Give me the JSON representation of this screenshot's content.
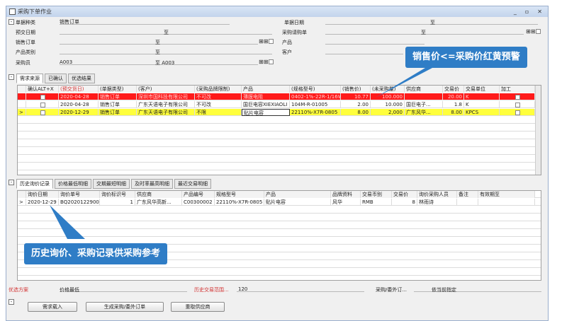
{
  "window": {
    "title": "采购下单作业",
    "minimize": "_",
    "maximize": "▫",
    "close": "✕"
  },
  "filters": {
    "doc_type_label": "单据种类",
    "doc_type_value": "销售订单",
    "doc_date_label": "单据日期",
    "doc_date_to": "至",
    "delivery_date_label": "预交日期",
    "delivery_date_to": "至",
    "purchase_req_label": "采购请购单",
    "purchase_req_to": "至",
    "sales_order_label": "销售订单",
    "sales_order_to": "至",
    "product_label": "产品",
    "product_to": "至",
    "product_cat_label": "产品类别",
    "product_cat_to": "至",
    "customer_label": "客户",
    "buyer_label": "采购员",
    "buyer_from": "A003",
    "buyer_to": "至 A003"
  },
  "upper_tabs": [
    "需求来源",
    "已确认",
    "优选结果"
  ],
  "upper_grid": {
    "columns": [
      "确认ALT+X",
      "(预交货日)",
      "(单据类型)",
      "(客户)",
      "(采购品牌限制)",
      "产品",
      "(规格型号)",
      "(销售价)",
      "(未采购量)",
      "供应商",
      "交易价",
      "交易单位",
      "加工"
    ],
    "rows": [
      {
        "date": "2020-04-28",
        "type": "销售订单",
        "customer": "深圳市国科技有限公司",
        "brand": "不可改",
        "product": "薄膜电阻",
        "spec": "0402-1%-22R-1/16W",
        "price": "10.77",
        "qty": "100.000",
        "supplier": "",
        "trade_price": "20.00",
        "unit": "K",
        "style": "red"
      },
      {
        "date": "2020-04-28",
        "type": "销售订单",
        "customer": "广东天语电子有限公司",
        "brand": "不可改",
        "product": "国巨电容XIEXIAOLI",
        "spec": "104M-R-01005",
        "price": "2.00",
        "qty": "10.000",
        "supplier": "国巨电子...",
        "trade_price": "1.8",
        "unit": "K",
        "style": "normal"
      },
      {
        "date": "2020-12-29",
        "type": "销售订单",
        "customer": "广东天语电子有限公司",
        "brand": "不限",
        "product": "贴片电容",
        "spec": "22110%-X7R-0805",
        "price": "8.00",
        "qty": "2,000",
        "supplier": "广东风华...",
        "trade_price": "8.00",
        "unit": "KPCS",
        "style": "yellow"
      }
    ]
  },
  "lower_tabs": [
    "历史询价记录",
    "价格最低明细",
    "交期最短明细",
    "及时率最高明细",
    "最近交易明细"
  ],
  "lower_grid": {
    "columns": [
      "询价日期",
      "询价单号",
      "询价标识号",
      "供应商",
      "产品编号",
      "规格型号",
      "产品",
      "品牌资料",
      "交易币别",
      "交易价",
      "询价采购人员",
      "备注",
      "有效期至"
    ],
    "rows": [
      {
        "date": "2020-12-29",
        "no": "BQ202012290001",
        "id": "1",
        "supplier": "广东风华高新...",
        "code": "C00300002",
        "spec": "22110%-X7R-0805",
        "product": "贴片电容",
        "brand": "风华",
        "currency": "RMB",
        "price": "8",
        "person": "林雨诗",
        "note": "",
        "valid": ""
      }
    ]
  },
  "bottom": {
    "scheme_label": "优选方案",
    "scheme_value": "价格最低",
    "range_label": "历史交易范围...",
    "range_value": "120",
    "mode_label": "采购/委外订...",
    "mode_value": "依当前指定"
  },
  "buttons": {
    "import": "需求载入",
    "generate": "生成采购/委外订单",
    "reselect": "重取供应商"
  },
  "callouts": {
    "top": "销售价<=采购价红黄预警",
    "bottom": "历史询价、采购记录供采购参考"
  }
}
